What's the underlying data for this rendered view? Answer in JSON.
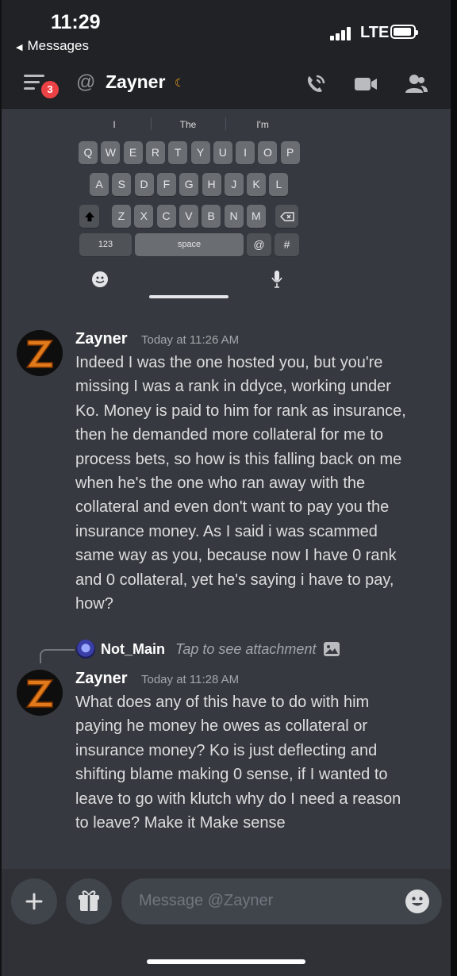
{
  "status_bar": {
    "time": "11:29",
    "back_label": "Messages",
    "network": "LTE"
  },
  "header": {
    "unread_count": "3",
    "channel_name": "Zayner",
    "icons": [
      "menu-icon",
      "at-icon",
      "moon-icon",
      "voice-call-icon",
      "video-call-icon",
      "members-icon"
    ]
  },
  "keyboard": {
    "suggestions": [
      "I",
      "The",
      "I'm"
    ],
    "row1": [
      "Q",
      "W",
      "E",
      "R",
      "T",
      "Y",
      "U",
      "I",
      "O",
      "P"
    ],
    "row2": [
      "A",
      "S",
      "D",
      "F",
      "G",
      "H",
      "J",
      "K",
      "L"
    ],
    "row3": [
      "Z",
      "X",
      "C",
      "V",
      "B",
      "N",
      "M"
    ],
    "numbers_key": "123",
    "space_key": "space",
    "at_key": "@",
    "hash_key": "#"
  },
  "messages": [
    {
      "author": "Zayner",
      "timestamp": "Today at 11:26 AM",
      "text": "Indeed I was the one hosted you, but you're\nmissing I was a rank in ddyce, working under\nKo. Money is paid to him for rank as insurance,\nthen he demanded more collateral for me to\nprocess bets, so how is this falling back on me\nwhen he's the one who ran away with the\ncollateral and even don't want to pay you the\ninsurance money. As I said i was scammed\nsame way as you, because now I have 0 rank\nand 0 collateral, yet he's saying i have to pay,\nhow?"
    },
    {
      "reply_to": {
        "author": "Not_Main",
        "text": "Tap to see attachment"
      },
      "author": "Zayner",
      "timestamp": "Today at 11:28 AM",
      "text": "What does any of this have to do with him\npaying he money he owes as collateral or\ninsurance money? Ko is just deflecting and\nshifting blame making 0 sense, if I wanted to\nleave to go with klutch why do I need a reason\nto leave? Make it Make sense"
    }
  ],
  "composer": {
    "placeholder": "Message @Zayner"
  },
  "colors": {
    "background": "#36393f",
    "header": "#202225",
    "badge": "#ed4245",
    "text": "#dcddde",
    "muted": "#a3a6aa"
  }
}
